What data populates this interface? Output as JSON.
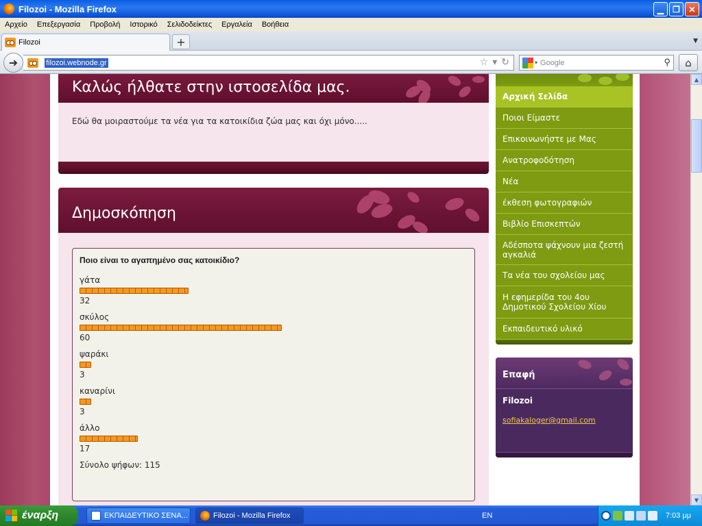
{
  "window": {
    "title": "Filozoi - Mozilla Firefox"
  },
  "menubar": [
    "Αρχείο",
    "Επεξεργασία",
    "Προβολή",
    "Ιστορικό",
    "Σελιδοδείκτες",
    "Εργαλεία",
    "Βοήθεια"
  ],
  "tab": {
    "label": "Filozoi",
    "new_tab": "+"
  },
  "nav": {
    "url": "filozoi.webnode.gr",
    "search_placeholder": "Google"
  },
  "welcome": {
    "title": "Καλώς ήλθατε στην ιστοσελίδα μας.",
    "text": "Εδώ θα μοιραστούμε τα νέα για τα κατοικίδια ζώα μας και όχι μόνο....."
  },
  "poll": {
    "heading": "Δημοσκόπηση",
    "question": "Ποιο είναι το αγαπημένο σας κατοικίδιο?",
    "options": [
      {
        "label": "γάτα",
        "count": "32",
        "share": 0.28
      },
      {
        "label": "σκύλος",
        "count": "60",
        "share": 0.52
      },
      {
        "label": "ψαράκι",
        "count": "3",
        "share": 0.03
      },
      {
        "label": "καναρίνι",
        "count": "3",
        "share": 0.03
      },
      {
        "label": "άλλο",
        "count": "17",
        "share": 0.15
      }
    ],
    "total": "Σύνολο ψήφων: 115"
  },
  "sidebar": {
    "items": [
      {
        "label": "Αρχική Σελίδα"
      },
      {
        "label": "Ποιοι Είμαστε"
      },
      {
        "label": "Επικοινωνήστε με Μας"
      },
      {
        "label": "Ανατροφοδότηση"
      },
      {
        "label": "Νέα"
      },
      {
        "label": "έκθεση φωτογραφιών"
      },
      {
        "label": "Βιβλίο Επισκεπτών"
      },
      {
        "label": "Αδέσποτα ψάχνουν μια ζεστή αγκαλιά"
      },
      {
        "label": "Τα νέα του σχολείου μας"
      },
      {
        "label": "Η εφημερίδα του 4ου Δημοτικού Σχολείου Χίου"
      },
      {
        "label": "Εκπαιδευτικό υλικό"
      }
    ]
  },
  "contact": {
    "heading": "Επαφή",
    "name": "Filozoi",
    "email": "sofiakaloger@gmail.com"
  },
  "taskbar": {
    "start": "έναρξη",
    "tasks": [
      "ΕΚΠΑΙΔΕΥΤΙΚΟ ΣΕΝΑ...",
      "Filozoi - Mozilla Firefox"
    ],
    "lang": "EN",
    "clock": "7:03 μμ"
  },
  "colors": {
    "accent_wine": "#6e1533",
    "menu_green": "#7e9b12",
    "contact_purple": "#4a2a5e",
    "bar_orange": "#f29a1f"
  }
}
